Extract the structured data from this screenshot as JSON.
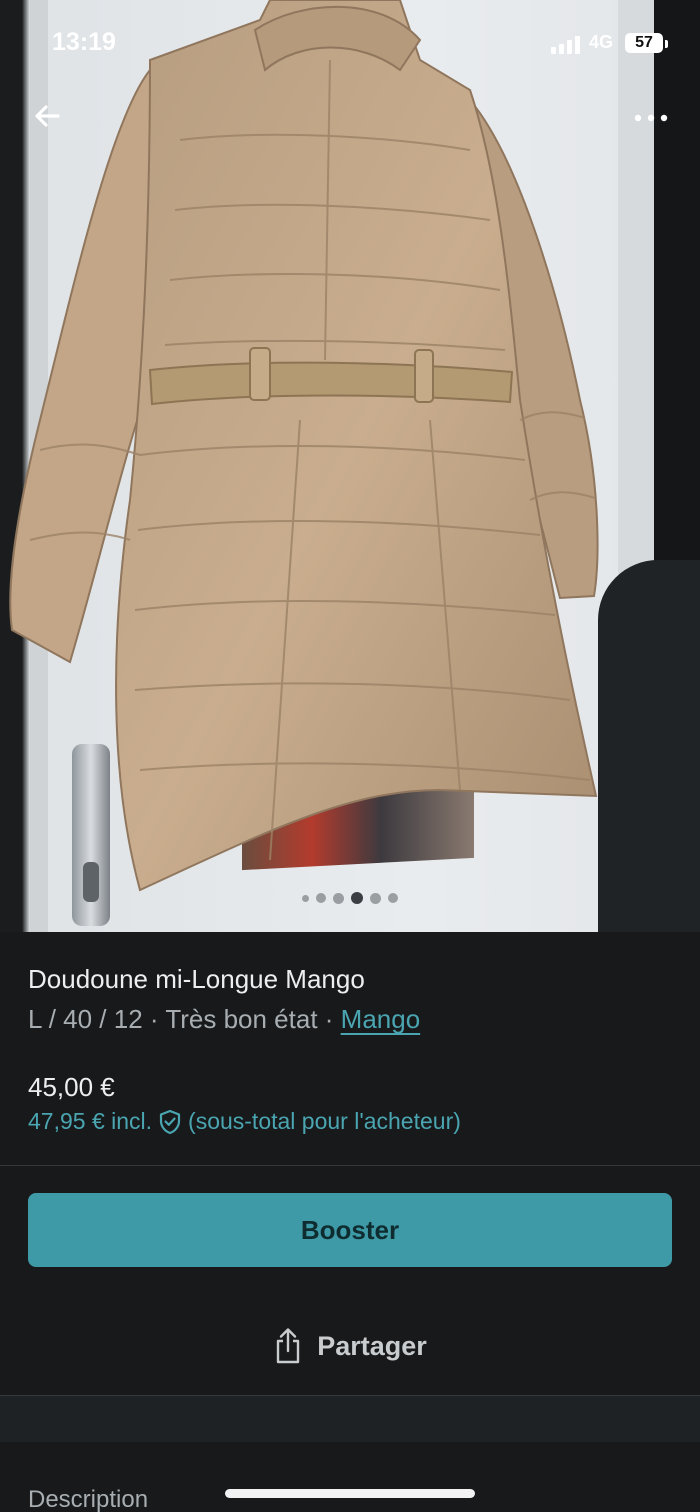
{
  "status_bar": {
    "time": "13:19",
    "network": "4G",
    "battery": "57"
  },
  "photo": {
    "slide_count": 6,
    "active_slide_index": 3
  },
  "item": {
    "title": "Doudoune mi-Longue Mango",
    "details": "L / 40 / 12 · Très bon état · ",
    "brand": "Mango",
    "price": "45,00 €",
    "price_incl": "47,95 € incl.",
    "price_note": "(sous-total pour l'acheteur)"
  },
  "actions": {
    "booster_label": "Booster",
    "share_label": "Partager"
  },
  "description": {
    "heading": "Description"
  },
  "colors": {
    "accent": "#3d9aa6",
    "link": "#4aa5b1",
    "background": "#17191b"
  },
  "icons": [
    "back-arrow-icon",
    "more-dots-icon",
    "shield-check-icon",
    "share-icon"
  ]
}
